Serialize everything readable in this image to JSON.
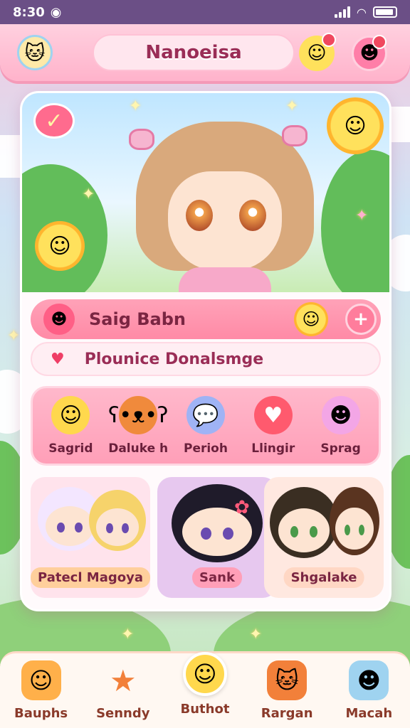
{
  "status": {
    "time": "8:30"
  },
  "header": {
    "title": "Nanoeisa"
  },
  "hero": {
    "alt": ""
  },
  "rows": {
    "primary": {
      "label": "Saig Babn",
      "action_symbol": "+"
    },
    "secondary": {
      "label": "Plounice Donalsmge"
    }
  },
  "categories": [
    {
      "label": "Sagrid",
      "icon": "sun-face-icon"
    },
    {
      "label": "Daluke h",
      "icon": "bear-face-icon"
    },
    {
      "label": "Perioh",
      "icon": "speech-bubble-icon"
    },
    {
      "label": "Llingir",
      "icon": "heart-icon"
    },
    {
      "label": "Sprag",
      "icon": "bunny-face-icon"
    }
  ],
  "friends": [
    {
      "label": "Patecl Magoya"
    },
    {
      "label": "Sank"
    },
    {
      "label": "Shgalake"
    }
  ],
  "bottom_nav": [
    {
      "label": "Bauphs",
      "icon": "speech-icon"
    },
    {
      "label": "Senndy",
      "icon": "star-icon"
    },
    {
      "label": "Buthot",
      "icon": "smiley-icon"
    },
    {
      "label": "Rargan",
      "icon": "cat-icon"
    },
    {
      "label": "Macah",
      "icon": "robot-icon"
    }
  ],
  "colors": {
    "accent_pink": "#ff8aa6",
    "header_pink": "#ffb3cb",
    "status_bar": "#6b4f86",
    "sun_yellow": "#ffe15c"
  }
}
